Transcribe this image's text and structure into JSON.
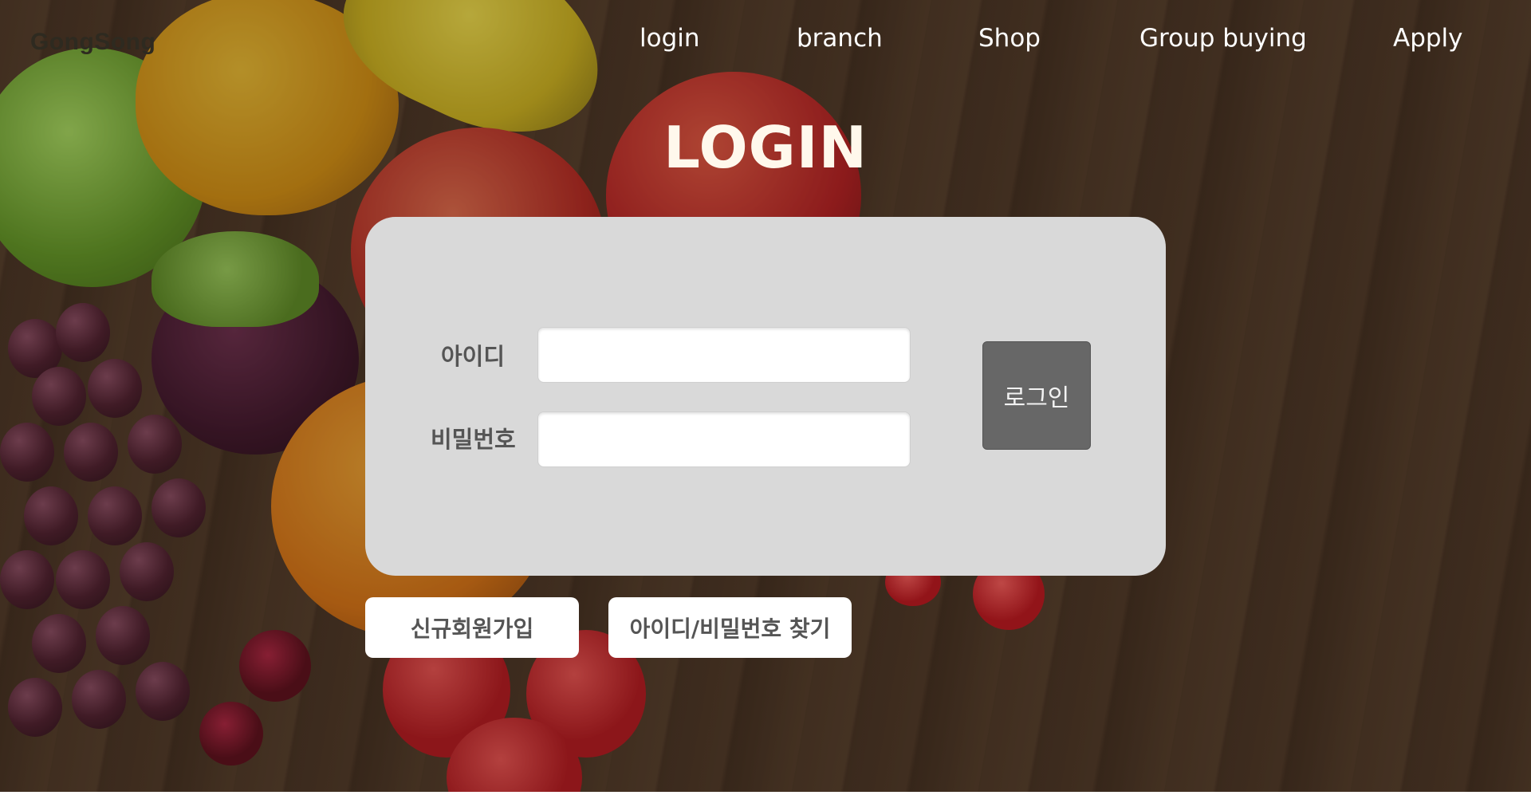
{
  "brand": {
    "logo_text": "GongSong"
  },
  "nav": {
    "items": [
      {
        "label": "login"
      },
      {
        "label": "branch"
      },
      {
        "label": "Shop"
      },
      {
        "label": "Group buying"
      },
      {
        "label": "Apply"
      }
    ]
  },
  "page": {
    "title": "LOGIN"
  },
  "login_form": {
    "id_label": "아이디",
    "id_value": "",
    "password_label": "비밀번호",
    "password_value": "",
    "submit_label": "로그인"
  },
  "links": {
    "signup_label": "신규회원가입",
    "find_account_label": "아이디/비밀번호 찾기"
  },
  "colors": {
    "card_bg": "#d9d9d9",
    "submit_bg": "#676767",
    "title": "#fff8ec"
  }
}
